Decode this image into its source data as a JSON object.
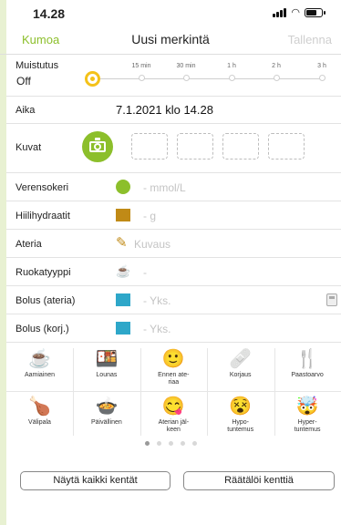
{
  "status_bar": {
    "time": "14.28"
  },
  "nav": {
    "cancel": "Kumoa",
    "title": "Uusi merkintä",
    "save": "Tallenna"
  },
  "reminder": {
    "label": "Muistutus",
    "value": "Off",
    "ticks": [
      "15 min",
      "30 min",
      "1 h",
      "2 h",
      "3 h"
    ]
  },
  "time_row": {
    "label": "Aika",
    "value": "7.1.2021 klo 14.28"
  },
  "images_row": {
    "label": "Kuvat"
  },
  "fields": [
    {
      "label": "Verensokeri",
      "hint": "-  mmol/L",
      "icon": "blood-drop-icon"
    },
    {
      "label": "Hiilihydraatit",
      "hint": "-  g",
      "icon": "carbs-icon"
    },
    {
      "label": "Ateria",
      "hint": "Kuvaus",
      "icon": "meal-note-icon"
    },
    {
      "label": "Ruokatyyppi",
      "hint": "-",
      "icon": "food-type-icon"
    },
    {
      "label": "Bolus (ateria)",
      "hint": "-  Yks.",
      "icon": "insulin-bolus-icon"
    },
    {
      "label": "Bolus (korj.)",
      "hint": "-  Yks.",
      "icon": "insulin-correction-icon"
    }
  ],
  "quick_tags": [
    {
      "label": "Aamiainen",
      "glyph": "☕",
      "icon": "breakfast-icon"
    },
    {
      "label": "Lounas",
      "glyph": "🍱",
      "icon": "lunch-icon"
    },
    {
      "label": "Ennen ate-\nriaa",
      "glyph": "🙂",
      "icon": "before-meal-icon"
    },
    {
      "label": "Korjaus",
      "glyph": "🩹",
      "icon": "correction-icon"
    },
    {
      "label": "Paastoarvo",
      "glyph": "🍴",
      "icon": "fasting-icon"
    },
    {
      "label": "Välipala",
      "glyph": "🍗",
      "icon": "snack-icon"
    },
    {
      "label": "Päivällinen",
      "glyph": "🍲",
      "icon": "dinner-icon"
    },
    {
      "label": "Aterian jäl-\nkeen",
      "glyph": "😋",
      "icon": "after-meal-icon"
    },
    {
      "label": "Hypo-\ntuntemus",
      "glyph": "😵",
      "icon": "hypo-icon"
    },
    {
      "label": "Hyper-\ntuntemus",
      "glyph": "🤯",
      "icon": "hyper-icon"
    }
  ],
  "pager": {
    "pages": 5,
    "current": 1
  },
  "buttons": {
    "show_all": "Näytä kaikki kentät",
    "customize": "Räätälöi kenttiä"
  },
  "colors": {
    "accent": "#8cbf2b",
    "reminder": "#f4c21a",
    "carbs": "#c08a16",
    "insulin": "#2ea7c9"
  }
}
